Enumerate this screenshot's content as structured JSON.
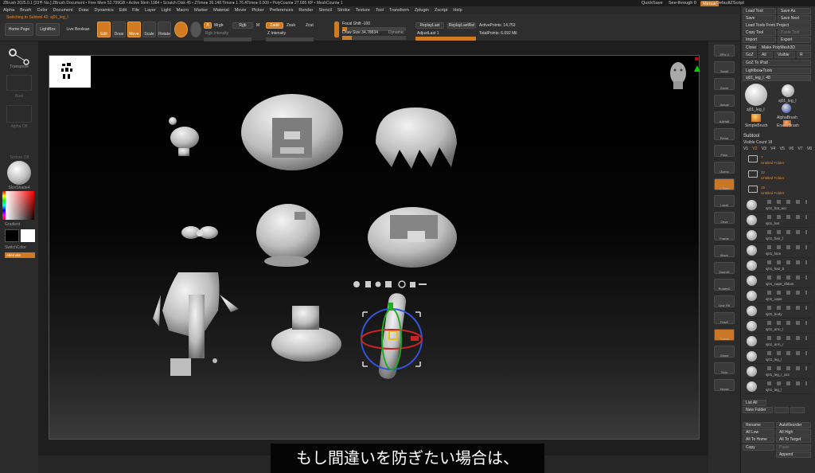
{
  "titlebar": "ZBrush 2025.0.1 [23부 No.]   ZBrush Document   • Free Mem 52.799GB • Active Mem 1084 • Scratch Disk 45 • ZTime● 36.148 Timer● 1.76 ATime● 0.009 • PolyCount● 27.685 KP • MeshCount● 1",
  "top_right": {
    "quicksave": "QuickSave",
    "see_through": "See-through 0",
    "menus": "Menus",
    "default_zscript": "DefaultZScript"
  },
  "menus": [
    "Alpha",
    "Brush",
    "Color",
    "Document",
    "Draw",
    "Dynamics",
    "Edit",
    "File",
    "Layer",
    "Light",
    "Macro",
    "Marker",
    "Material",
    "Movie",
    "Picker",
    "Preferences",
    "Render",
    "Stencil",
    "Stroke",
    "Texture",
    "Tool",
    "Transform",
    "Zplugin",
    "Zscript",
    "Help"
  ],
  "status_line": "Switching to Subtool 42: sj01_leg_l",
  "toolbar": {
    "home_page": "Home Page",
    "lightbox": "LightBox",
    "live_boolean": "Live Boolean",
    "edit": "Edit",
    "draw": "Draw",
    "move": "Move",
    "scale": "Scale",
    "rotate": "Rotate",
    "mrgb": "Mrgb",
    "rgb": "Rgb",
    "m": "M",
    "zadd": "Zadd",
    "zsub": "Zsub",
    "zcut": "Zcut",
    "rgb_intensity": "Rgb Intensity",
    "z_intensity": "Z Intensity",
    "focal_shift": "Focal Shift -100",
    "draw_size": "Draw Size 34.78834",
    "dynamic": "Dynamic",
    "replay_last": "ReplayLast",
    "replay_last_rel": "ReplayLastRel",
    "adjust_last": "AdjustLast 1",
    "active_points": "ActivePoints: 14,753",
    "total_points": "TotalPoints: 6.092 Mil"
  },
  "left_shelf": {
    "transpose": "Transpose",
    "bust": "Bust",
    "alpha_off": "Alpha Off",
    "texture_off": "Texture Off",
    "material": "SkinShade4",
    "gradient": "Gradient",
    "switch_color": "SwitchColor",
    "alternate": "Alternate"
  },
  "right_shelf": [
    "SPix 3",
    "Scroll",
    "Zoom",
    "Actual",
    "AAHalf",
    "Persp",
    "Floor",
    "Gizmo",
    "L.Sym",
    "Local",
    "Qxyz",
    "Frame",
    "Move",
    "ZoomD",
    "RotateD",
    "Line Fill",
    "PolyF",
    "Transp",
    "Ghost",
    "Solo",
    "Xpose"
  ],
  "right_panel": {
    "load_tool": "Load Tool",
    "save_as": "Save As",
    "save": "Save",
    "save_next": "Save Next",
    "load_tools_from_project": "Load Tools From Project",
    "copy_tool": "Copy Tool",
    "paste_tool": "Paste Tool",
    "import": "Import",
    "export": "Export",
    "clone": "Clone",
    "make_polymesh": "Make PolyMesh3D",
    "goz": "GoZ",
    "all": "All",
    "visible": "Visible",
    "r": "R",
    "goz_to_ipad": "GoZ To iPad",
    "lightbox_tools": "Lightbox▸Tools",
    "current_tool": "sj01_leg_l. 48",
    "brushes": [
      "sj01_leg_l",
      "sj01_leg_l",
      "SimpleBrush",
      "AlphaBrush",
      "EraserBrush"
    ],
    "subtool_title": "Subtool",
    "visible_count": "Visible Count 18",
    "versions": [
      "V1",
      "V2",
      "V3",
      "V4",
      "V5",
      "V6",
      "V7",
      "V8"
    ],
    "folders": [
      {
        "count": "7",
        "name": "Untitled Folder"
      },
      {
        "count": "22",
        "name": "Untitled Folder"
      },
      {
        "count": "15",
        "name": "Untitled Folder"
      }
    ],
    "subtools": [
      "sj01_hat_acc",
      "sj01_hat",
      "sj01_hair_f",
      "sj01_face",
      "sj01_hair_b",
      "sj01_cape_ribbon",
      "sj01_cape",
      "sj01_body",
      "sj01_arm_l",
      "sj01_arm_r",
      "sj01_leg_l",
      "sj01_leg_r_acc",
      "sj01_leg_l"
    ],
    "list_all": "List All",
    "new_folder": "New Folder",
    "rename": "Rename",
    "autoreorder": "AutoReorder",
    "all_low": "All Low",
    "all_high": "All High",
    "all_to_home": "All To Home",
    "all_to_target": "All To Target",
    "copy": "Copy",
    "paste": "Paste",
    "append": "Append"
  },
  "subtitle": "もし間違いを防ぎたい場合は、",
  "colors": {
    "accent": "#d07b22",
    "panel": "#2f2f2f",
    "canvas": "#000000"
  }
}
